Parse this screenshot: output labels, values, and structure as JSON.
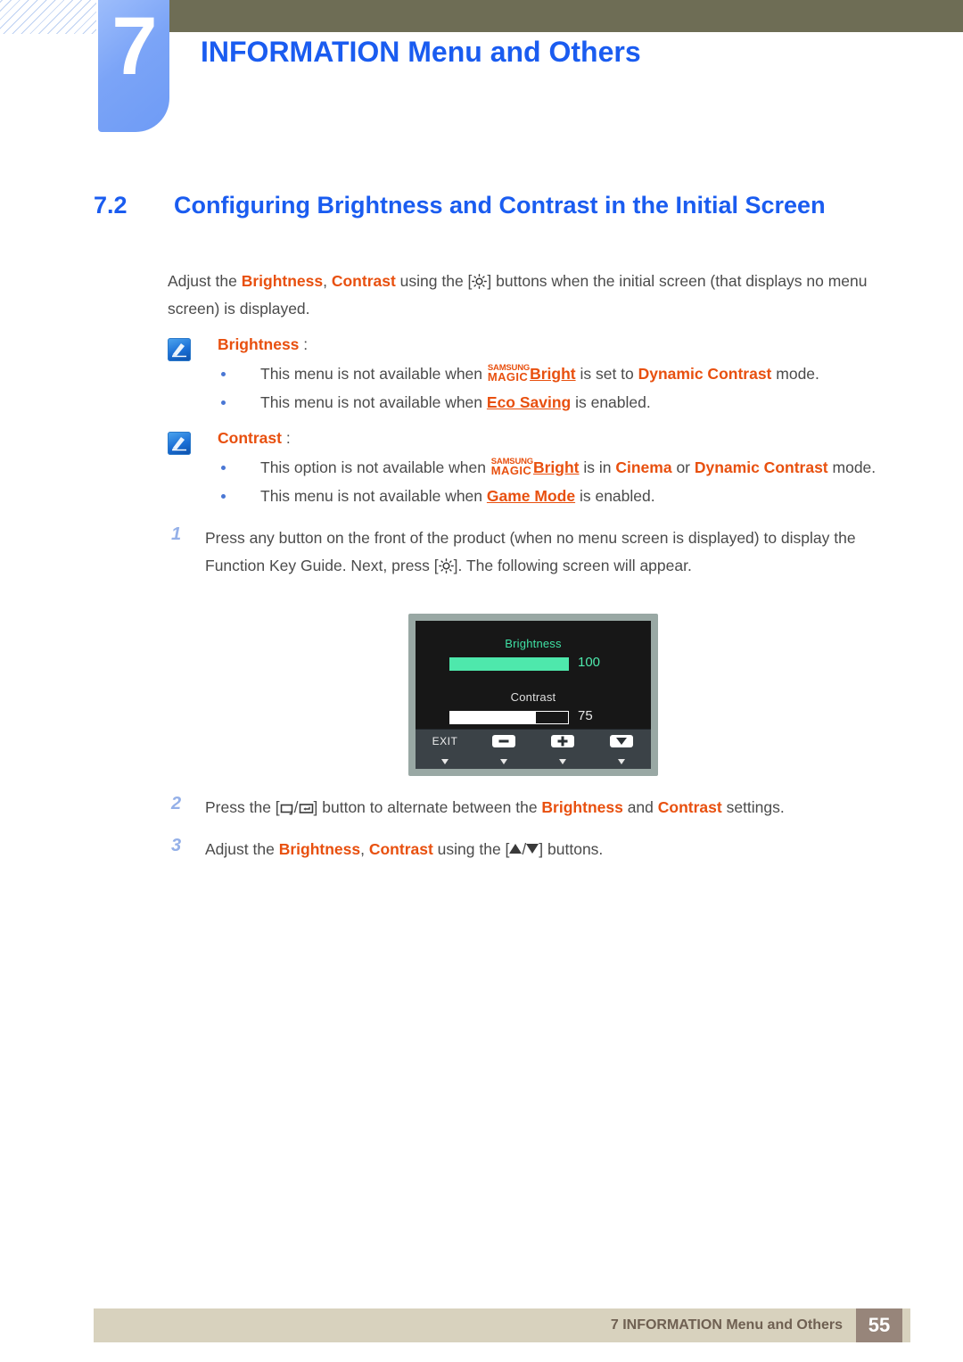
{
  "header": {
    "chapter_number": "7",
    "chapter_title": "INFORMATION Menu and Others"
  },
  "section": {
    "number": "7.2",
    "title": "Configuring Brightness and Contrast in the Initial Screen"
  },
  "intro": {
    "t1": "Adjust the ",
    "b1": "Brightness",
    "t2": ", ",
    "b2": "Contrast",
    "t3": " using the [",
    "icon": "brightness-sun-icon",
    "t4": "] buttons when the initial screen (that displays no menu screen) is displayed."
  },
  "notes": [
    {
      "title": "Brightness",
      "colon": " :",
      "bullets": [
        {
          "t1": "This menu is not available when ",
          "brand_top": "SAMSUNG",
          "brand_bottom": "MAGIC",
          "brand_word": "Bright",
          "t2": " is set to ",
          "hl": "Dynamic Contrast",
          "t3": " mode."
        },
        {
          "t1": "This menu is not available when ",
          "hl_u": "Eco Saving",
          "t2": " is enabled."
        }
      ]
    },
    {
      "title": "Contrast",
      "colon": " :",
      "bullets": [
        {
          "t1": "This option is not available when ",
          "brand_top": "SAMSUNG",
          "brand_bottom": "MAGIC",
          "brand_word": "Bright",
          "t2": " is in ",
          "hl1": "Cinema",
          "t3": " or ",
          "hl2": "Dynamic Contrast",
          "t4": " mode."
        },
        {
          "t1": "This menu is not available when ",
          "hl_u": "Game Mode",
          "t2": " is enabled."
        }
      ]
    }
  ],
  "steps": {
    "s1": {
      "num": "1",
      "t1": "Press any button on the front of the product (when no menu screen is displayed) to display the Function Key Guide. Next, press [",
      "t2": "]. The following screen will appear."
    },
    "s2": {
      "num": "2",
      "t1": "Press the [",
      "sep": "/",
      "t2": "] button to alternate between the ",
      "b1": "Brightness",
      "t3": " and ",
      "b2": "Contrast",
      "t4": " settings."
    },
    "s3": {
      "num": "3",
      "t1": "Adjust the ",
      "b1": "Brightness",
      "t2": ", ",
      "b2": "Contrast",
      "t3": " using the [",
      "sep": "/",
      "t4": "] buttons."
    }
  },
  "osd": {
    "brightness_label": "Brightness",
    "brightness_value": "100",
    "brightness_percent": 100,
    "contrast_label": "Contrast",
    "contrast_value": "75",
    "contrast_percent": 73,
    "exit_label": "EXIT",
    "buttons": [
      "minus-button",
      "plus-button",
      "down-button"
    ],
    "colors": {
      "accent_green": "#4ee8ac",
      "panel": "#171717",
      "frame": "#99a8a4",
      "footer": "#3b4247"
    }
  },
  "footer": {
    "text": "7 INFORMATION Menu and Others",
    "page": "55"
  },
  "colors": {
    "heading_blue": "#1a5cf0",
    "highlight_orange": "#e8500f",
    "olive": "#6e6d55",
    "tab_blue": "#7ba4f7",
    "footer_beige": "#d8d2be",
    "footer_page_box": "#97857a"
  }
}
